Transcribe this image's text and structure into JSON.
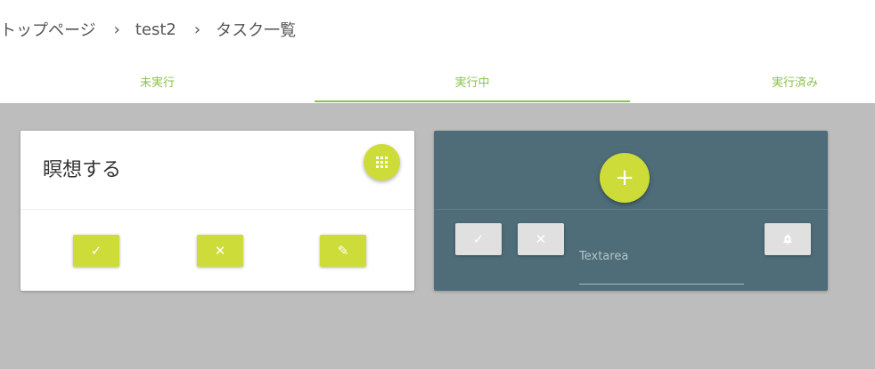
{
  "breadcrumb": {
    "items": [
      "トップページ",
      "test2",
      "タスク一覧"
    ],
    "separator": "›"
  },
  "tabs": [
    {
      "label": "未実行",
      "active": false
    },
    {
      "label": "実行中",
      "active": true
    },
    {
      "label": "実行済み",
      "active": false
    }
  ],
  "task_card": {
    "title": "瞑想する",
    "menu_icon": "apps-grid-icon",
    "actions": [
      {
        "name": "complete",
        "icon": "check-icon",
        "glyph": "✓"
      },
      {
        "name": "cancel",
        "icon": "close-icon",
        "glyph": "✕"
      },
      {
        "name": "edit",
        "icon": "pencil-icon",
        "glyph": "✎"
      }
    ]
  },
  "new_card": {
    "add_glyph": "+",
    "textarea_placeholder": "Textarea",
    "actions": [
      {
        "name": "confirm",
        "glyph": "✓"
      },
      {
        "name": "cancel",
        "glyph": "✕"
      },
      {
        "name": "bell",
        "glyph": "🔔"
      }
    ]
  },
  "colors": {
    "accent": "#cddc39",
    "tab_text": "#8bc34a",
    "background": "#bdbdbd",
    "new_card_bg": "#4e6d78"
  }
}
